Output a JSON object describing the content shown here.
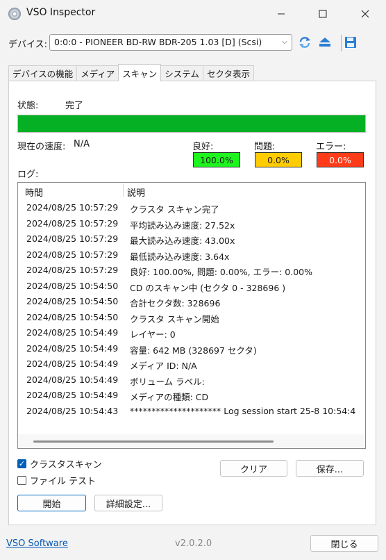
{
  "window": {
    "title": "VSO Inspector",
    "controls": {
      "minimize": "—",
      "maximize": "☐",
      "close": "✕"
    }
  },
  "device": {
    "label": "デバイス:",
    "selected": "0:0:0 - PIONEER BD-RW   BDR-205 1.03 [D] (Scsi)",
    "icons": [
      "refresh-icon",
      "eject-icon",
      "save-icon"
    ]
  },
  "tabs": [
    {
      "label": "デバイスの機能",
      "active": false
    },
    {
      "label": "メディア",
      "active": false
    },
    {
      "label": "スキャン",
      "active": true
    },
    {
      "label": "システム",
      "active": false
    },
    {
      "label": "セクタ表示",
      "active": false
    }
  ],
  "scan": {
    "status_label": "状態:",
    "status_value": "完了",
    "progress": 1.0,
    "progress_color": "#06b025",
    "speed_label": "現在の速度:",
    "speed_value": "N/A",
    "good_label": "良好:",
    "good_value": "100.0%",
    "good_color": "#1ef51e",
    "problem_label": "問題:",
    "problem_value": "0.0%",
    "problem_color": "#ffcc00",
    "error_label": "エラー:",
    "error_value": "0.0%",
    "error_color": "#ff3b1a"
  },
  "log": {
    "label": "ログ:",
    "col_time": "時間",
    "col_desc": "説明",
    "rows": [
      {
        "time": "2024/08/25 10:57:29",
        "desc": "クラスタ スキャン完了"
      },
      {
        "time": "2024/08/25 10:57:29",
        "desc": "平均読み込み速度: 27.52x"
      },
      {
        "time": "2024/08/25 10:57:29",
        "desc": "最大読み込み速度: 43.00x"
      },
      {
        "time": "2024/08/25 10:57:29",
        "desc": "最低読み込み速度: 3.64x"
      },
      {
        "time": "2024/08/25 10:57:29",
        "desc": "良好: 100.00%, 問題: 0.00%, エラー: 0.00%"
      },
      {
        "time": "2024/08/25 10:54:50",
        "desc": "CD のスキャン中 (セクタ 0 - 328696 )"
      },
      {
        "time": "2024/08/25 10:54:50",
        "desc": "合計セクタ数: 328696"
      },
      {
        "time": "2024/08/25 10:54:50",
        "desc": "クラスタ スキャン開始"
      },
      {
        "time": "2024/08/25 10:54:49",
        "desc": "レイヤー: 0"
      },
      {
        "time": "2024/08/25 10:54:49",
        "desc": "容量: 642 MB (328697 セクタ)"
      },
      {
        "time": "2024/08/25 10:54:49",
        "desc": "メディア ID: N/A"
      },
      {
        "time": "2024/08/25 10:54:49",
        "desc": "ボリューム ラベル:"
      },
      {
        "time": "2024/08/25 10:54:49",
        "desc": "メディアの種類: CD"
      },
      {
        "time": "2024/08/25 10:54:43",
        "desc": "********************* Log session start 25-8 10:54:4"
      }
    ]
  },
  "options": {
    "cluster_scan_label": "クラスタスキャン",
    "cluster_scan_checked": true,
    "file_test_label": "ファイル テスト",
    "file_test_checked": false
  },
  "buttons": {
    "clear": "クリア",
    "save": "保存...",
    "start": "開始",
    "advanced": "詳細設定...",
    "close": "閉じる"
  },
  "footer": {
    "link": "VSO Software",
    "version": "v2.0.2.0"
  }
}
